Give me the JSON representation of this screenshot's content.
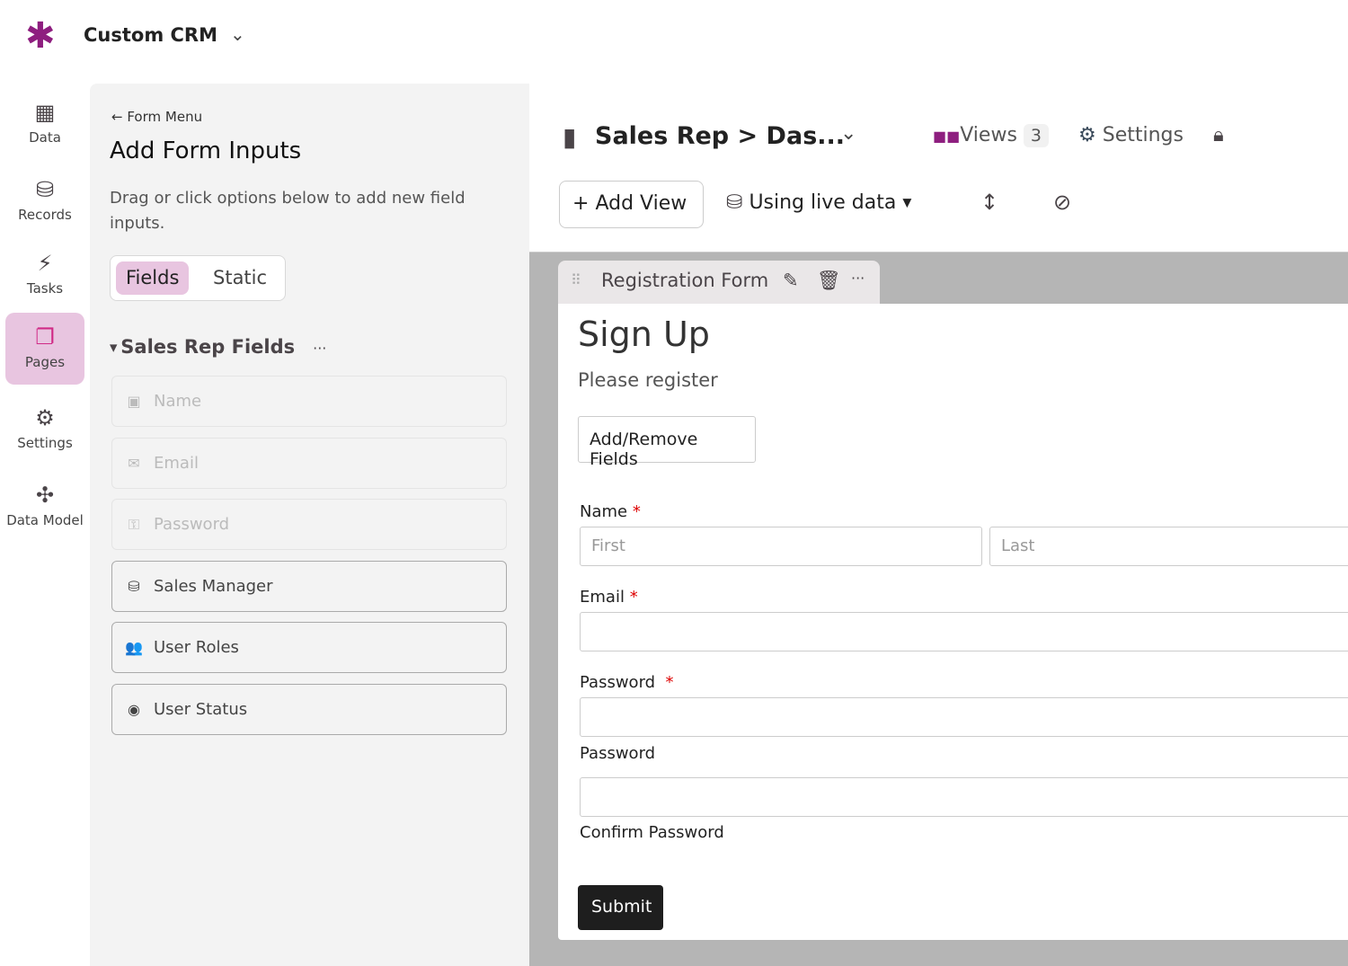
{
  "app": {
    "name": "Custom CRM"
  },
  "nav": [
    {
      "label": "Data",
      "icon": "table-icon"
    },
    {
      "label": "Records",
      "icon": "database-icon"
    },
    {
      "label": "Tasks",
      "icon": "bolt-icon"
    },
    {
      "label": "Pages",
      "icon": "pages-icon",
      "active": true
    },
    {
      "label": "Settings",
      "icon": "gear-icon"
    },
    {
      "label": "Data Model",
      "icon": "graph-icon"
    }
  ],
  "panel": {
    "back": "Form Menu",
    "title": "Add Form Inputs",
    "description": "Drag or click options below to add new field inputs.",
    "tabs": [
      "Fields",
      "Static"
    ],
    "section": "Sales Rep Fields",
    "section_more": "···",
    "fields": [
      {
        "label": "Name",
        "disabled": true
      },
      {
        "label": "Email",
        "disabled": true
      },
      {
        "label": "Password",
        "disabled": true
      },
      {
        "label": "Sales Manager"
      },
      {
        "label": "User Roles"
      },
      {
        "label": "User Status"
      }
    ]
  },
  "header": {
    "title": "Sales Rep > Das...",
    "views_label": "Views",
    "views_count": "3",
    "settings": "Settings",
    "add_view": "Add View",
    "data_source": "Using live data"
  },
  "form": {
    "tab": "Registration Form",
    "title": "Sign Up",
    "subtitle": "Please register",
    "add_remove": "Add/Remove Fields",
    "name_label": "Name",
    "first_placeholder": "First",
    "last_placeholder": "Last",
    "email_label": "Email",
    "password_label": "Password",
    "password_sub": "Password",
    "confirm_sub": "Confirm Password",
    "required": "*",
    "submit": "Submit"
  },
  "colors": {
    "brand": "#8e1e7f",
    "active_nav": "#e8c5e0"
  }
}
